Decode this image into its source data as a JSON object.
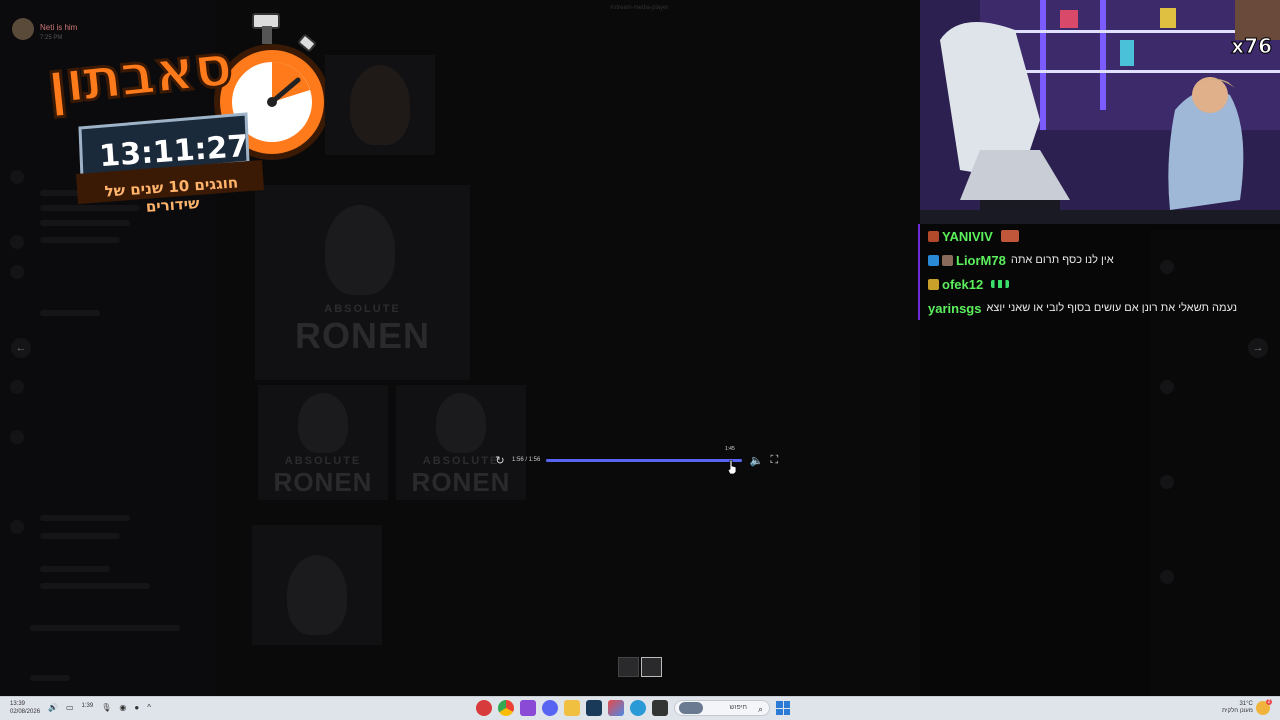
{
  "window": {
    "top_caption": "#stream-media-player",
    "uploader_name": "Neti is him",
    "uploader_time": "7:25 PM"
  },
  "overlay": {
    "title": "סאבתון",
    "timer": "13:11:27",
    "subtitle": "חוגגים 10 שנים של שידורים",
    "sub_multiplier": "x76"
  },
  "poster": {
    "brand_small": "ABSOLUTE",
    "brand_big": "RONEN"
  },
  "chat": {
    "messages": [
      {
        "username": "YANIVIV",
        "text": "",
        "name_color": "#5cf05c",
        "badge_color": "#b04a2a",
        "has_emote": true
      },
      {
        "username": "LiorM78",
        "text": "אין לנו כסף תרום אתה",
        "name_color": "#5cf05c",
        "badge_color": "#2a8ad6",
        "has_emote": false
      },
      {
        "username": "ofek12",
        "text": "",
        "name_color": "#5cf05c",
        "badge_color": "#c9a02a",
        "has_emote": true
      },
      {
        "username": "yarinsgs",
        "text": "נעמה תשאלי את רונן אם עושים בסוף לובי או שאני יוצא",
        "name_color": "#5cf05c",
        "badge_color": "",
        "has_emote": false
      }
    ]
  },
  "player": {
    "time_display": "1:56 / 1:56",
    "hover_time": "1:45",
    "progress_fraction": 1.0,
    "hover_fraction": 0.89
  },
  "nav": {
    "prev_label": "←",
    "next_label": "→"
  },
  "taskbar": {
    "clock_time": "13:39",
    "clock_date": "02/08/2026",
    "volume_label": "1:39",
    "search_placeholder": "חיפוש",
    "weather_temp": "31°C",
    "weather_desc": "מעונן חלקית",
    "notification_count": "2"
  },
  "colors": {
    "accent": "#5865f2",
    "chat_border": "#6b2bd6",
    "logo_orange": "#ff7a1a"
  }
}
